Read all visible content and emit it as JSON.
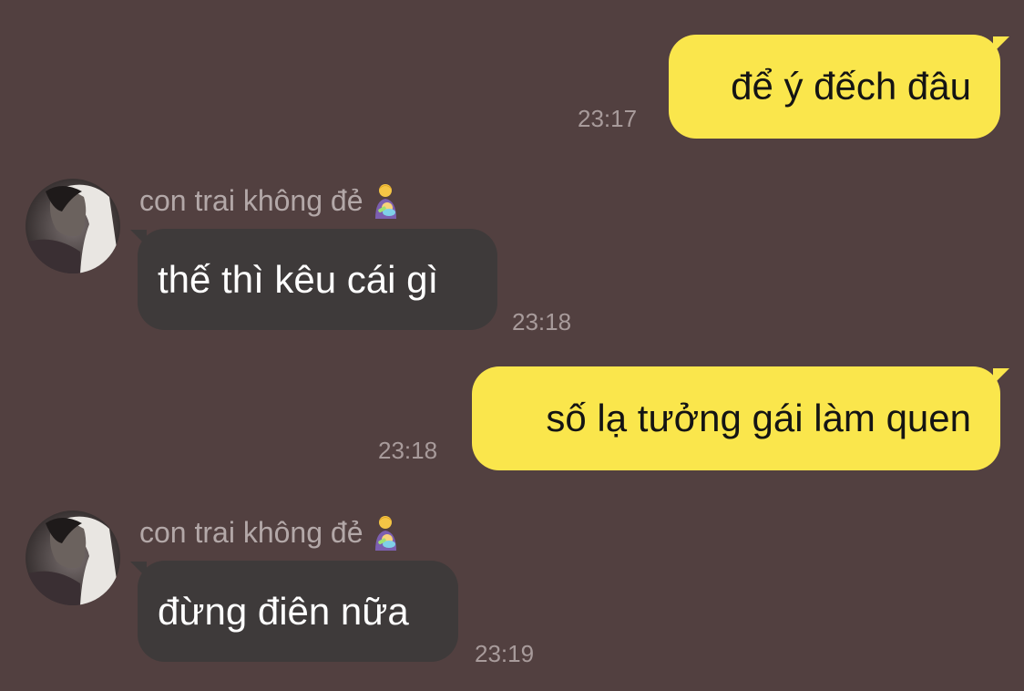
{
  "colors": {
    "background": "#524040",
    "outgoing_bubble": "#FAE64C",
    "incoming_bubble": "#3E3A3A",
    "timestamp": "#A89B9B",
    "sender_name": "#B3A8A8"
  },
  "messages": [
    {
      "direction": "outgoing",
      "text": "để ý đếch đâu",
      "time": "23:17"
    },
    {
      "direction": "incoming",
      "sender": "con trai không đẻ",
      "sender_icon": "man-feeding-baby-icon",
      "text": "thế thì kêu cái gì",
      "time": "23:18"
    },
    {
      "direction": "outgoing",
      "text": "số lạ tưởng gái làm quen",
      "time": "23:18"
    },
    {
      "direction": "incoming",
      "sender": "con trai không đẻ",
      "sender_icon": "man-feeding-baby-icon",
      "text": "đừng điên nữa",
      "time": "23:19"
    }
  ]
}
